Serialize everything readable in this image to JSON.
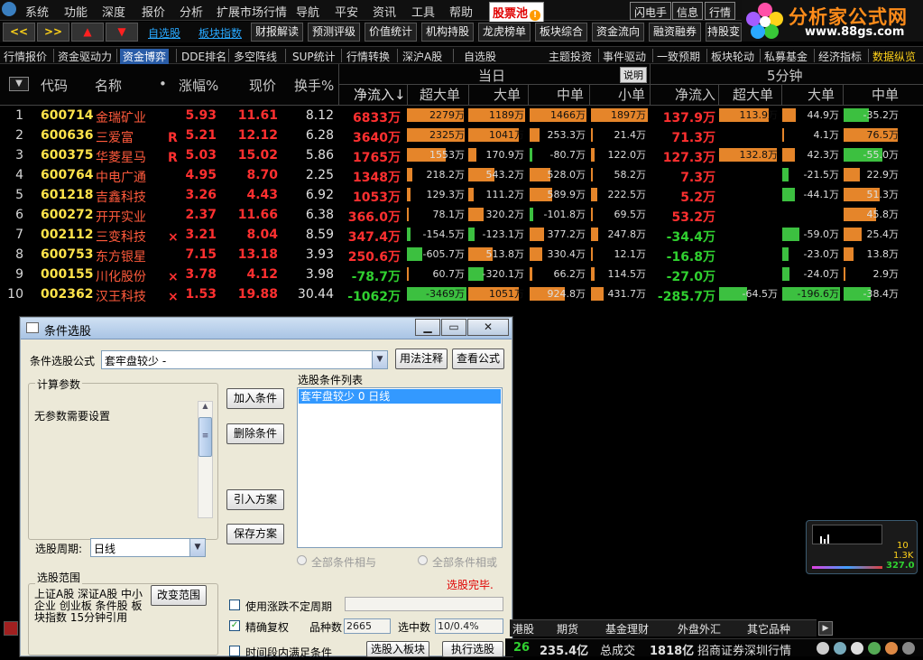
{
  "menu": {
    "items": [
      "系统",
      "功能",
      "深度",
      "报价",
      "分析",
      "扩展市场行情",
      "导航",
      "平安",
      "资讯",
      "工具",
      "帮助"
    ],
    "hot": "股票池",
    "right_buttons": [
      "闪电手",
      "信息",
      "行情"
    ]
  },
  "logo": {
    "title": "分析家公式网",
    "url": "www.88gs.com"
  },
  "toolbar": {
    "nav_buttons": [
      "<<",
      ">>",
      "▲",
      "▼"
    ],
    "links": [
      "自选股",
      "板块指数"
    ],
    "buttons": [
      "财报解读",
      "预测评级",
      "价值统计",
      "机构持股",
      "龙虎榜单",
      "板块综合",
      "资金流向",
      "融资融券",
      "持股变"
    ]
  },
  "tabs": {
    "left": [
      "行情报价",
      "资金驱动力",
      "资金博弈",
      "DDE排名",
      "多空阵线",
      "SUP统计",
      "行情转换",
      "深沪A股",
      "自选股"
    ],
    "active_index": 2,
    "right": [
      "主题投资",
      "事件驱动",
      "一致预期",
      "板块轮动",
      "私募基金",
      "经济指标",
      "数据纵览"
    ]
  },
  "header": {
    "sort_icon": "▼",
    "code": "代码",
    "name": "名称",
    "dot": "•",
    "pct": "涨幅%",
    "price": "现价",
    "turnover": "换手%",
    "today": "当日",
    "explain_button": "说明",
    "five_min": "5分钟",
    "today_cols": [
      "净流入↓",
      "超大单",
      "大单",
      "中单",
      "小单"
    ],
    "five_cols": [
      "净流入",
      "超大单",
      "大单",
      "中单"
    ]
  },
  "rows": [
    {
      "n": "1",
      "code": "600714",
      "name": "金瑞矿业",
      "mark": "",
      "pct": "5.93",
      "price": "11.61",
      "turn": "8.12",
      "net": "6833万",
      "b1": "2279万",
      "b2": "1189万",
      "b3": "1466万",
      "b4": "1897万",
      "f_net": "137.9万",
      "f1": "113.9万",
      "f2": "44.9万",
      "f3": "-35.2万"
    },
    {
      "n": "2",
      "code": "600636",
      "name": "三爱富",
      "mark": "R",
      "pct": "5.21",
      "price": "12.12",
      "turn": "6.28",
      "net": "3640万",
      "b1": "2325万",
      "b2": "1041万",
      "b3": "253.3万",
      "b4": "21.4万",
      "f_net": "71.3万",
      "f1": "",
      "f2": "4.1万",
      "f3": "76.5万"
    },
    {
      "n": "3",
      "code": "600375",
      "name": "华菱星马",
      "mark": "R",
      "pct": "5.03",
      "price": "15.02",
      "turn": "5.86",
      "net": "1765万",
      "b1": "1553万",
      "b2": "170.9万",
      "b3": "-80.7万",
      "b4": "122.0万",
      "f_net": "127.3万",
      "f1": "132.8万",
      "f2": "42.3万",
      "f3": "-55.0万"
    },
    {
      "n": "4",
      "code": "600764",
      "name": "中电广通",
      "mark": "",
      "pct": "4.95",
      "price": "8.70",
      "turn": "2.25",
      "net": "1348万",
      "b1": "218.2万",
      "b2": "543.2万",
      "b3": "528.0万",
      "b4": "58.2万",
      "f_net": "7.3万",
      "f1": "",
      "f2": "-21.5万",
      "f3": "22.9万"
    },
    {
      "n": "5",
      "code": "601218",
      "name": "吉鑫科技",
      "mark": "",
      "pct": "3.26",
      "price": "4.43",
      "turn": "6.92",
      "net": "1053万",
      "b1": "129.3万",
      "b2": "111.2万",
      "b3": "589.9万",
      "b4": "222.5万",
      "f_net": "5.2万",
      "f1": "",
      "f2": "-44.1万",
      "f3": "51.3万"
    },
    {
      "n": "6",
      "code": "600272",
      "name": "开开实业",
      "mark": "",
      "pct": "2.37",
      "price": "11.66",
      "turn": "6.38",
      "net": "366.0万",
      "b1": "78.1万",
      "b2": "320.2万",
      "b3": "-101.8万",
      "b4": "69.5万",
      "f_net": "53.2万",
      "f1": "",
      "f2": "",
      "f3": "45.8万"
    },
    {
      "n": "7",
      "code": "002112",
      "name": "三变科技",
      "mark": "×",
      "pct": "3.21",
      "price": "8.04",
      "turn": "8.59",
      "net": "347.4万",
      "b1": "-154.5万",
      "b2": "-123.1万",
      "b3": "377.2万",
      "b4": "247.8万",
      "f_net": "-34.4万",
      "f1": "",
      "f2": "-59.0万",
      "f3": "25.4万"
    },
    {
      "n": "8",
      "code": "600753",
      "name": "东方银星",
      "mark": "",
      "pct": "7.15",
      "price": "13.18",
      "turn": "3.93",
      "net": "250.6万",
      "b1": "-605.7万",
      "b2": "513.8万",
      "b3": "330.4万",
      "b4": "12.1万",
      "f_net": "-16.8万",
      "f1": "",
      "f2": "-23.0万",
      "f3": "13.8万"
    },
    {
      "n": "9",
      "code": "000155",
      "name": "川化股份",
      "mark": "×",
      "pct": "3.78",
      "price": "4.12",
      "turn": "3.98",
      "net": "-78.7万",
      "b1": "60.7万",
      "b2": "-320.1万",
      "b3": "66.2万",
      "b4": "114.5万",
      "f_net": "-27.0万",
      "f1": "",
      "f2": "-24.0万",
      "f3": "2.9万"
    },
    {
      "n": "10",
      "code": "002362",
      "name": "汉王科技",
      "mark": "×",
      "pct": "1.53",
      "price": "19.88",
      "turn": "30.44",
      "net": "-1062万",
      "b1": "-3469万",
      "b2": "1051万",
      "b3": "924.8万",
      "b4": "431.7万",
      "f_net": "-285.7万",
      "f1": "-64.5万",
      "f2": "-196.6万",
      "f3": "-38.4万"
    }
  ],
  "dialog": {
    "title": "条件选股",
    "formula_label": "条件选股公式",
    "formula_value": "套牢盘较少 -",
    "usage_button": "用法注释",
    "view_button": "查看公式",
    "calc_group": "计算参数",
    "no_params": "无参数需要设置",
    "add_button": "加入条件",
    "delete_button": "删除条件",
    "import_button": "引入方案",
    "save_button": "保存方案",
    "list_label": "选股条件列表",
    "list_item": "套牢盘较少  0  日线",
    "period_label": "选股周期:",
    "period_value": "日线",
    "all_and": "全部条件相与",
    "all_or": "全部条件相或",
    "done": "选股完毕.",
    "range_group": "选股范围",
    "range_text": "上证A股 深证A股 中小企业 创业板 条件股 板块指数 15分钟引用",
    "change_range": "改变范围",
    "use_indefinite": "使用涨跌不定周期",
    "precise": "精确复权",
    "count_label": "品种数",
    "count_value": "2665",
    "selected_label": "选中数",
    "selected_value": "10/0.4%",
    "period_cond": "时间段内满足条件",
    "to_block": "选股入板块",
    "execute": "执行选股"
  },
  "bottom_tabs": [
    "港股",
    "期货",
    "基金理财",
    "外盘外汇",
    "其它品种"
  ],
  "status": {
    "num1": "26",
    "amount": "235.4亿",
    "vol_label": "总成交",
    "vol": "1818亿",
    "broker": "招商证券深圳行情"
  },
  "mini": {
    "v1": "10",
    "v2": "1.3K",
    "v3": "327.0"
  },
  "colors": {
    "up": "#ff3030",
    "down": "#30d030",
    "orange_bar": "#e5852a",
    "green_bar": "#3cc040",
    "code": "#ffe34a",
    "name": "#ff5a3c"
  }
}
